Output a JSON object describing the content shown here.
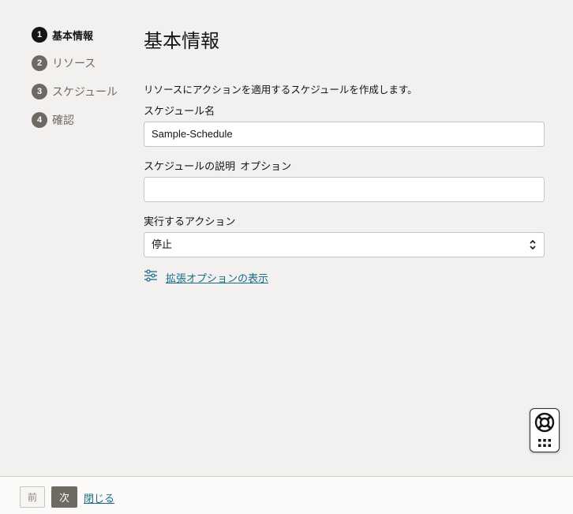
{
  "steps": [
    {
      "num": "1",
      "label": "基本情報"
    },
    {
      "num": "2",
      "label": "リソース"
    },
    {
      "num": "3",
      "label": "スケジュール"
    },
    {
      "num": "4",
      "label": "確認"
    }
  ],
  "main": {
    "title": "基本情報",
    "description": "リソースにアクションを適用するスケジュールを作成します。",
    "fields": {
      "schedule_name": {
        "label": "スケジュール名",
        "value": "Sample-Schedule"
      },
      "schedule_description": {
        "label": "スケジュールの説明",
        "optional": "オプション",
        "value": ""
      },
      "action": {
        "label": "実行するアクション",
        "value": "停止"
      }
    },
    "advanced_options_link": "拡張オプションの表示"
  },
  "footer": {
    "prev_label": "前",
    "next_label": "次",
    "close_label": "閉じる"
  },
  "icons": {
    "sliders": "sliders-icon",
    "chevron": "chevron-up-down-icon",
    "help": "lifebuoy-icon",
    "grid": "grid-icon"
  }
}
